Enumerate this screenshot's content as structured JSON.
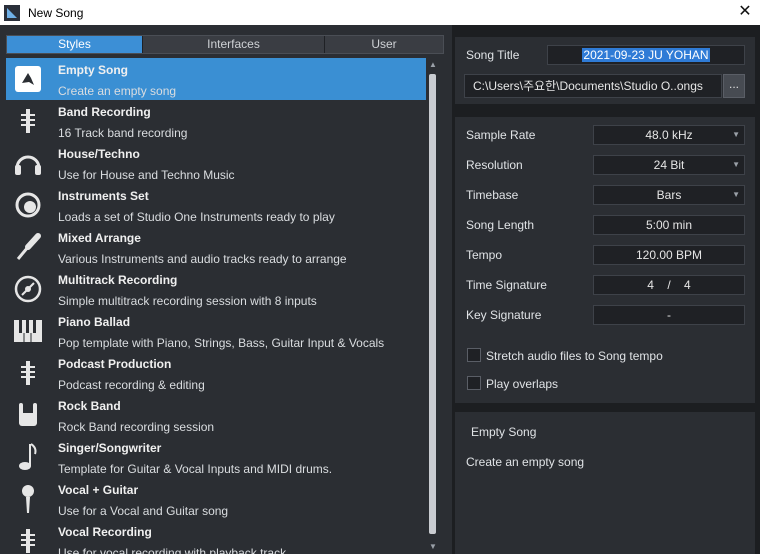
{
  "window": {
    "title": "New Song",
    "close": "✕"
  },
  "tabs": [
    {
      "label": "Styles",
      "active": true
    },
    {
      "label": "Interfaces",
      "active": false
    },
    {
      "label": "User",
      "active": false
    }
  ],
  "templates": [
    {
      "name": "Empty Song",
      "desc": "Create an empty song",
      "icon": "empty-song-icon",
      "selected": true
    },
    {
      "name": "Band Recording",
      "desc": "16 Track band recording",
      "icon": "mixer-icon"
    },
    {
      "name": "House/Techno",
      "desc": "Use for House and Techno Music",
      "icon": "headphones-icon"
    },
    {
      "name": "Instruments Set",
      "desc": "Loads a set of Studio One Instruments ready to play",
      "icon": "knob-icon"
    },
    {
      "name": "Mixed Arrange",
      "desc": "Various Instruments and audio tracks ready to arrange",
      "icon": "cable-icon"
    },
    {
      "name": "Multitrack Recording",
      "desc": "Simple multitrack recording session with 8 inputs",
      "icon": "disc-icon"
    },
    {
      "name": "Piano Ballad",
      "desc": "Pop template with Piano, Strings, Bass, Guitar Input & Vocals",
      "icon": "piano-icon"
    },
    {
      "name": "Podcast Production",
      "desc": "Podcast recording & editing",
      "icon": "mixer-icon"
    },
    {
      "name": "Rock Band",
      "desc": "Rock Band recording session",
      "icon": "rock-hand-icon"
    },
    {
      "name": "Singer/Songwriter",
      "desc": "Template for Guitar & Vocal Inputs and MIDI drums.",
      "icon": "music-note-icon"
    },
    {
      "name": "Vocal + Guitar",
      "desc": "Use for a Vocal and Guitar song",
      "icon": "microphone-icon"
    },
    {
      "name": "Vocal Recording",
      "desc": "Use for vocal recording with playback track",
      "icon": "mixer-icon"
    }
  ],
  "song": {
    "title_label": "Song Title",
    "title_value": "2021-09-23 JU YOHAN",
    "path_value": "C:\\Users\\주요한\\Documents\\Studio O..ongs",
    "browse_label": "..."
  },
  "settings": {
    "sample_rate_label": "Sample Rate",
    "sample_rate_value": "48.0 kHz",
    "resolution_label": "Resolution",
    "resolution_value": "24 Bit",
    "timebase_label": "Timebase",
    "timebase_value": "Bars",
    "length_label": "Song Length",
    "length_value": "5:00 min",
    "tempo_label": "Tempo",
    "tempo_value": "120.00 BPM",
    "timesig_label": "Time Signature",
    "timesig_num": "4",
    "timesig_sep": "/",
    "timesig_den": "4",
    "keysig_label": "Key Signature",
    "keysig_value": "-",
    "stretch_label": "Stretch audio files to Song tempo",
    "overlaps_label": "Play overlaps"
  },
  "description": {
    "title": "Empty Song",
    "text": "Create an empty song"
  },
  "colors": {
    "accent": "#3a8fd3",
    "panel": "#2b2e33",
    "background": "#1c1e21"
  }
}
